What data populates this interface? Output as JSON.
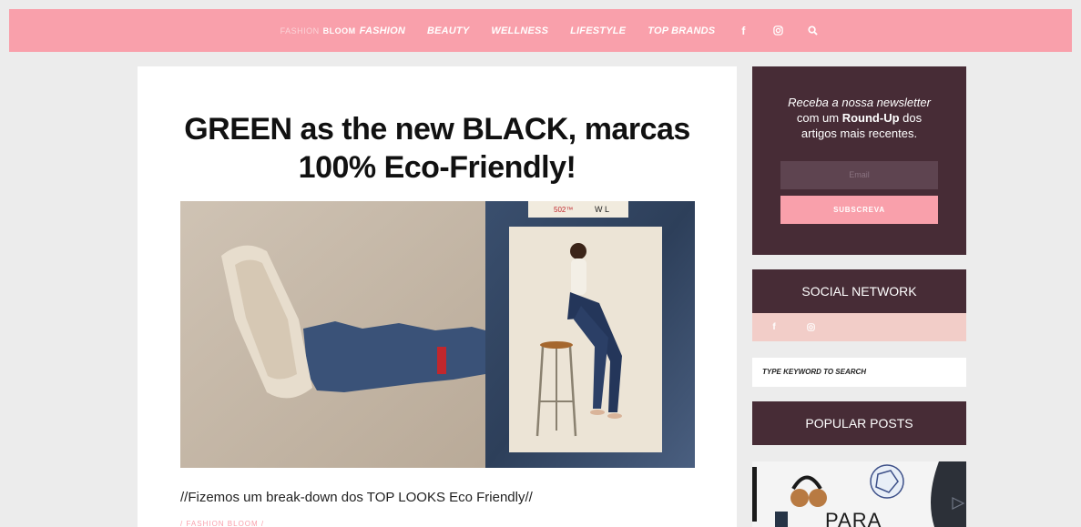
{
  "nav": {
    "logo_light": "FASHION",
    "logo_bold": "BLOOM",
    "items": [
      "FASHION",
      "BEAUTY",
      "WELLNESS",
      "LIFESTYLE",
      "TOP BRANDS"
    ],
    "icons": [
      "facebook-icon",
      "instagram-icon",
      "search-icon"
    ],
    "colors": {
      "bar": "#f9a0ab"
    }
  },
  "article": {
    "title": "GREEN as the new BLACK, marcas 100% Eco-Friendly!",
    "excerpt": "//Fizemos um break-down dos TOP LOOKS Eco Friendly//",
    "category": "/ FASHION BLOOM /",
    "hero_label_1": "502™",
    "hero_label_2": "W     L"
  },
  "sidebar": {
    "newsletter": {
      "line1": "Receba a nossa newsletter",
      "line2_pre": "com um ",
      "line2_bold": "Round-Up",
      "line2_post": " dos",
      "line3": "artigos mais recentes.",
      "email_placeholder": "Email",
      "subscribe_label": "SUBSCREVA"
    },
    "social_title": "SOCIAL NETWORK",
    "search_placeholder": "TYPE KEYWORD TO SEARCH",
    "popular_title": "POPULAR POSTS",
    "popular_thumb_text": "PARA",
    "colors": {
      "panel": "#472c36",
      "pink": "#f9a0ab",
      "social_bar": "#f2cdc8"
    }
  }
}
